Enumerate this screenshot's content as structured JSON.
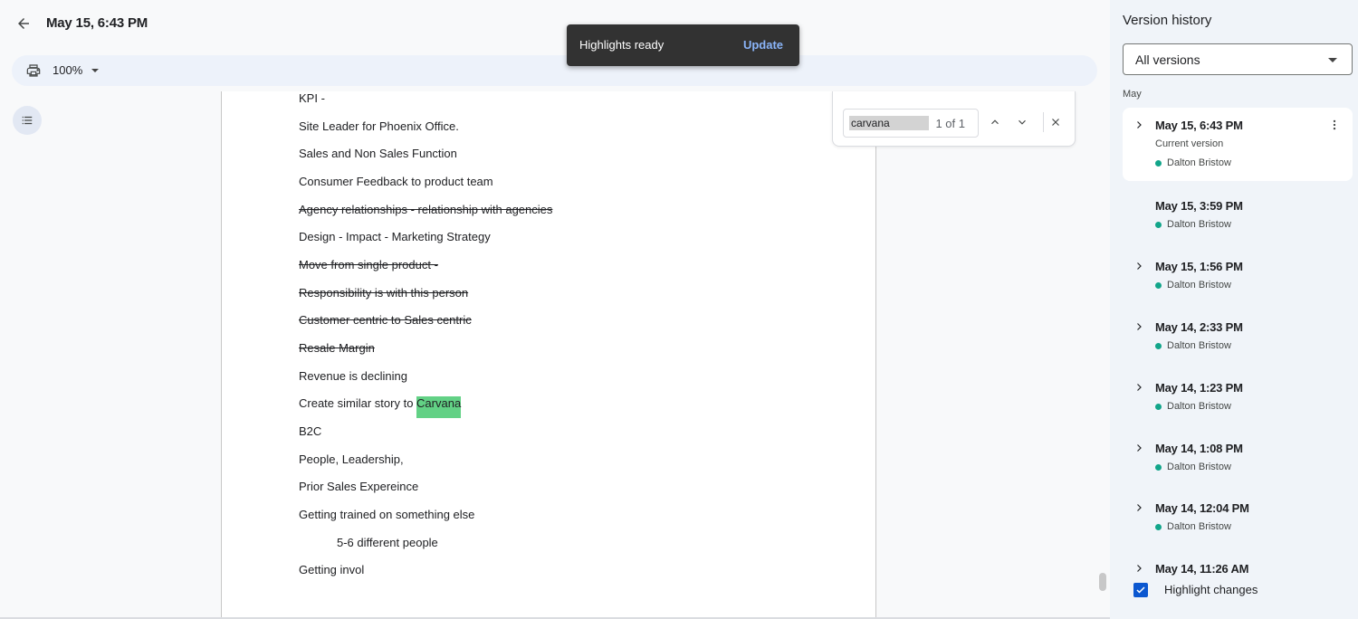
{
  "header": {
    "title": "May 15, 6:43 PM"
  },
  "toolbar": {
    "zoom": "100%"
  },
  "toast": {
    "message": "Highlights ready",
    "action": "Update"
  },
  "find": {
    "query": "carvana",
    "count": "1 of 1"
  },
  "document": {
    "lines": [
      "KPI -",
      "Site Leader for Phoenix Office.",
      "Sales and Non Sales Function",
      "Consumer Feedback to product team",
      "Agency relationships - relationship with agencies",
      "Design - Impact - Marketing Strategy",
      "Move from single product -",
      "Responsibility is with this person",
      "Customer centric to Sales centric",
      "Resale Margin",
      "Revenue is declining",
      "Create similar story to ",
      "B2C",
      "People, Leadership,",
      "Prior Sales Expereince",
      "Getting trained on something else",
      "5-6 different people",
      "Getting invol"
    ],
    "highlight": "Carvana"
  },
  "panel": {
    "title": "Version history",
    "filter": "All versions",
    "month": "May",
    "current_label": "Current version",
    "versions": [
      {
        "time": "May 15, 6:43 PM",
        "author": "Dalton Bristow"
      },
      {
        "time": "May 15, 3:59 PM",
        "author": "Dalton Bristow"
      },
      {
        "time": "May 15, 1:56 PM",
        "author": "Dalton Bristow"
      },
      {
        "time": "May 14, 2:33 PM",
        "author": "Dalton Bristow"
      },
      {
        "time": "May 14, 1:23 PM",
        "author": "Dalton Bristow"
      },
      {
        "time": "May 14, 1:08 PM",
        "author": "Dalton Bristow"
      },
      {
        "time": "May 14, 12:04 PM",
        "author": "Dalton Bristow"
      },
      {
        "time": "May 14, 11:26 AM"
      }
    ],
    "highlight_changes_label": "Highlight changes",
    "highlight_changes_checked": true
  },
  "colors": {
    "accent": "#0b57d0",
    "author_dot": "#12a58a",
    "find_highlight": "#62d185",
    "toast_bg": "#323232",
    "toast_action": "#8ab4f8"
  }
}
